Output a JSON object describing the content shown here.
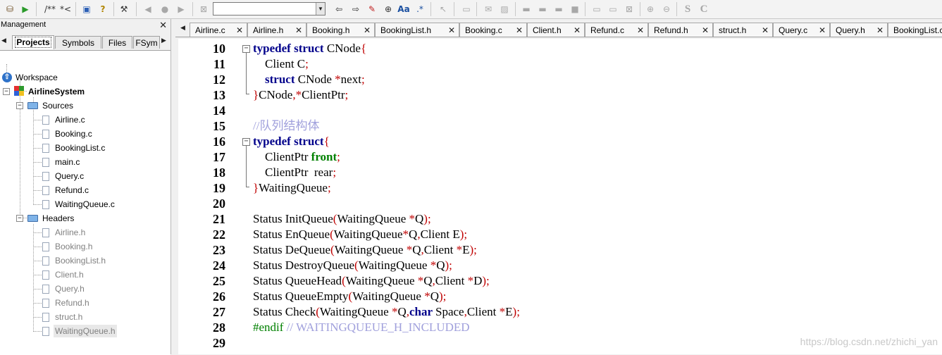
{
  "toolbar": {
    "comment_label": "/**",
    "uncomment_label": "*<",
    "aa_label": "Aa",
    "regex_label": ".*",
    "search_value": ""
  },
  "management": {
    "title": "Management",
    "close": "✕",
    "tabs": [
      "Projects",
      "Symbols",
      "Files",
      "FSym"
    ],
    "workspace": "Workspace",
    "project": "AirlineSystem",
    "sources_folder": "Sources",
    "headers_folder": "Headers",
    "sources": [
      "Airline.c",
      "Booking.c",
      "BookingList.c",
      "main.c",
      "Query.c",
      "Refund.c",
      "WaitingQueue.c"
    ],
    "headers": [
      "Airline.h",
      "Booking.h",
      "BookingList.h",
      "Client.h",
      "Query.h",
      "Refund.h",
      "struct.h",
      "WaitingQueue.h"
    ]
  },
  "editor": {
    "tabs": [
      "Airline.c",
      "Airline.h",
      "Booking.h",
      "BookingList.h",
      "Booking.c",
      "Client.h",
      "Refund.c",
      "Refund.h",
      "struct.h",
      "Query.c",
      "Query.h",
      "BookingList.c"
    ],
    "tab_close": "✕",
    "line_numbers": [
      "10",
      "11",
      "12",
      "13",
      "14",
      "15",
      "16",
      "17",
      "18",
      "19",
      "20",
      "21",
      "22",
      "23",
      "24",
      "25",
      "26",
      "27",
      "28",
      "29"
    ],
    "lines": [
      [
        [
          "kw",
          "typedef struct "
        ],
        [
          "",
          "CNode"
        ],
        [
          "op",
          "{"
        ]
      ],
      [
        [
          "",
          "    Client C"
        ],
        [
          "op",
          ";"
        ]
      ],
      [
        [
          "kw",
          "    struct "
        ],
        [
          "",
          "CNode "
        ],
        [
          "op",
          "*"
        ],
        [
          "",
          "next"
        ],
        [
          "op",
          ";"
        ]
      ],
      [
        [
          "op",
          "}"
        ],
        [
          "",
          "CNode"
        ],
        [
          "op",
          ",*"
        ],
        [
          "",
          "ClientPtr"
        ],
        [
          "op",
          ";"
        ]
      ],
      [],
      [
        [
          "cmt",
          "//队列结构体"
        ]
      ],
      [
        [
          "kw",
          "typedef struct"
        ],
        [
          "op",
          "{"
        ]
      ],
      [
        [
          "",
          "    ClientPtr "
        ],
        [
          "gkw",
          "front"
        ],
        [
          "op",
          ";"
        ]
      ],
      [
        [
          "",
          "    ClientPtr  rear"
        ],
        [
          "op",
          ";"
        ]
      ],
      [
        [
          "op",
          "}"
        ],
        [
          "",
          "WaitingQueue"
        ],
        [
          "op",
          ";"
        ]
      ],
      [],
      [
        [
          "",
          "Status InitQueue"
        ],
        [
          "op",
          "("
        ],
        [
          "",
          "WaitingQueue "
        ],
        [
          "op",
          "*"
        ],
        [
          "",
          "Q"
        ],
        [
          "op",
          ");"
        ]
      ],
      [
        [
          "",
          "Status EnQueue"
        ],
        [
          "op",
          "("
        ],
        [
          "",
          "WaitingQueue"
        ],
        [
          "op",
          "*"
        ],
        [
          "",
          "Q"
        ],
        [
          "op",
          ","
        ],
        [
          "",
          "Client E"
        ],
        [
          "op",
          ");"
        ]
      ],
      [
        [
          "",
          "Status DeQueue"
        ],
        [
          "op",
          "("
        ],
        [
          "",
          "WaitingQueue "
        ],
        [
          "op",
          "*"
        ],
        [
          "",
          "Q"
        ],
        [
          "op",
          ","
        ],
        [
          "",
          "Client "
        ],
        [
          "op",
          "*"
        ],
        [
          "",
          "E"
        ],
        [
          "op",
          ");"
        ]
      ],
      [
        [
          "",
          "Status DestroyQueue"
        ],
        [
          "op",
          "("
        ],
        [
          "",
          "WaitingQueue "
        ],
        [
          "op",
          "*"
        ],
        [
          "",
          "Q"
        ],
        [
          "op",
          ");"
        ]
      ],
      [
        [
          "",
          "Status QueueHead"
        ],
        [
          "op",
          "("
        ],
        [
          "",
          "WaitingQueue "
        ],
        [
          "op",
          "*"
        ],
        [
          "",
          "Q"
        ],
        [
          "op",
          ","
        ],
        [
          "",
          "Client "
        ],
        [
          "op",
          "*"
        ],
        [
          "",
          "D"
        ],
        [
          "op",
          ");"
        ]
      ],
      [
        [
          "",
          "Status QueueEmpty"
        ],
        [
          "op",
          "("
        ],
        [
          "",
          "WaitingQueue "
        ],
        [
          "op",
          "*"
        ],
        [
          "",
          "Q"
        ],
        [
          "op",
          ");"
        ]
      ],
      [
        [
          "",
          "Status Check"
        ],
        [
          "op",
          "("
        ],
        [
          "",
          "WaitingQueue "
        ],
        [
          "op",
          "*"
        ],
        [
          "",
          "Q"
        ],
        [
          "op",
          ","
        ],
        [
          "kw",
          "char "
        ],
        [
          "",
          "Space"
        ],
        [
          "op",
          ","
        ],
        [
          "",
          "Client "
        ],
        [
          "op",
          "*"
        ],
        [
          "",
          "E"
        ],
        [
          "op",
          ");"
        ]
      ],
      [
        [
          "pp",
          "#endif "
        ],
        [
          "cmt",
          "// WAITINGQUEUE_H_INCLUDED"
        ]
      ],
      []
    ]
  },
  "watermark": "https://blog.csdn.net/zhichi_yan"
}
